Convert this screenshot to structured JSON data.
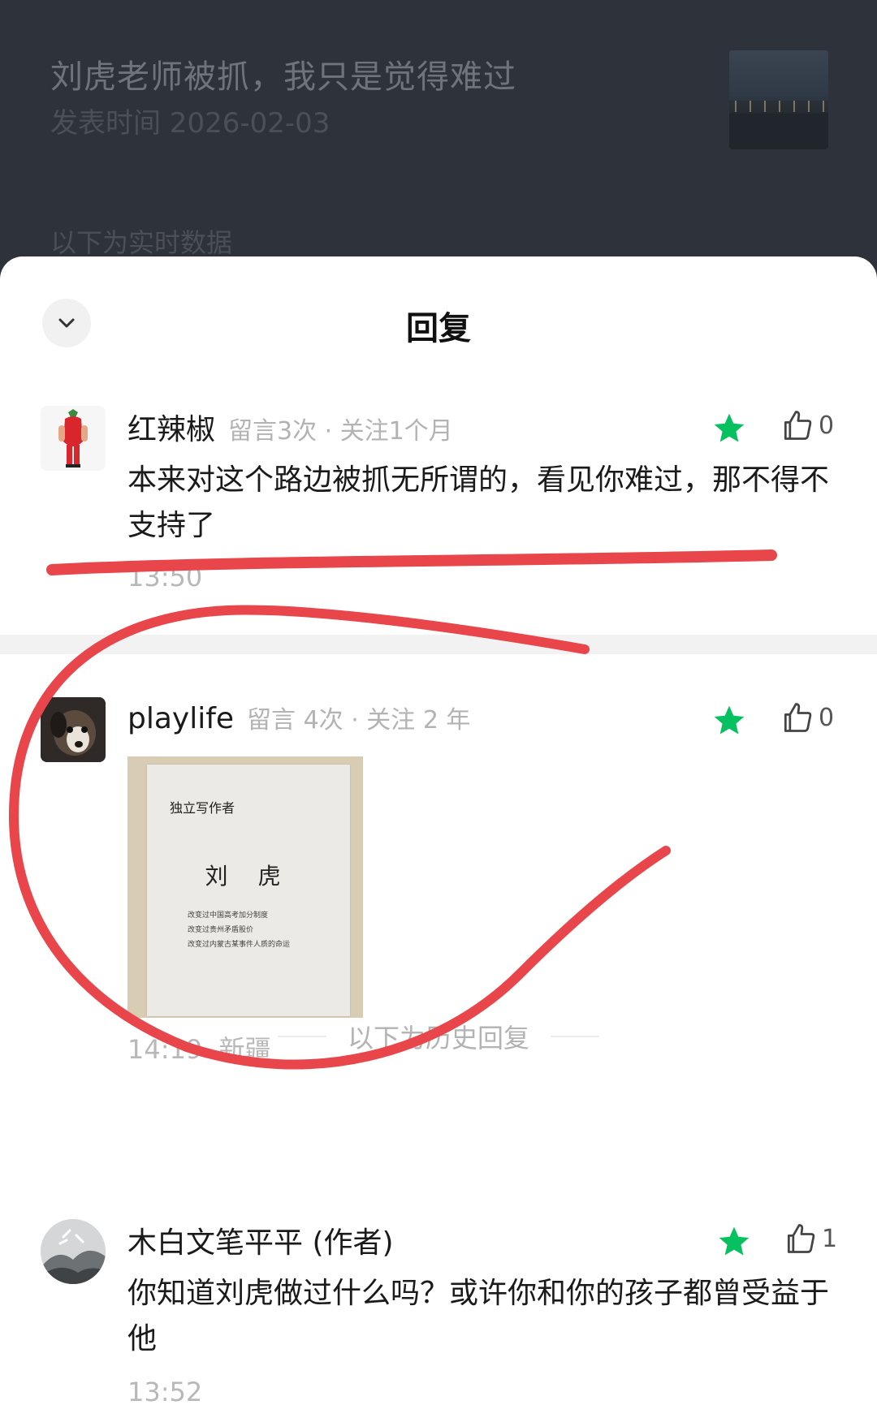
{
  "article": {
    "title": "刘虎老师被抓，我只是觉得难过",
    "published": "发表时间 2026-02-03",
    "realtime_label": "以下为实时数据"
  },
  "sheet": {
    "title": "回复",
    "collapse_icon": "chevron-down-icon"
  },
  "comments": [
    {
      "name": "红辣椒",
      "meta": "留言3次 · 关注1个月",
      "text": "本来对这个路边被抓无所谓的，看见你难过，那不得不支持了",
      "time": "13:50",
      "likes": "0",
      "starred": true
    },
    {
      "name": "playlife",
      "meta": "留言 4次 · 关注 2 年",
      "time": "14:19",
      "location": "新疆",
      "likes": "0",
      "starred": true,
      "attachment": {
        "heading": "独立写作者",
        "name": "刘 虎",
        "lines": [
          "改变过中国高考加分制度",
          "改变过贵州矛盾股价",
          "改变过内蒙古某事件人质的命运"
        ]
      }
    }
  ],
  "history": {
    "divider_label": "以下为历史回复",
    "comments": [
      {
        "name": "木白文笔平平 (作者)",
        "text": "你知道刘虎做过什么吗？或许你和你的孩子都曾受益于他",
        "time": "13:52",
        "likes": "1",
        "starred": true
      }
    ]
  },
  "colors": {
    "star": "#07c160",
    "annotation": "#e8464b",
    "overlay": "#2e323b"
  }
}
